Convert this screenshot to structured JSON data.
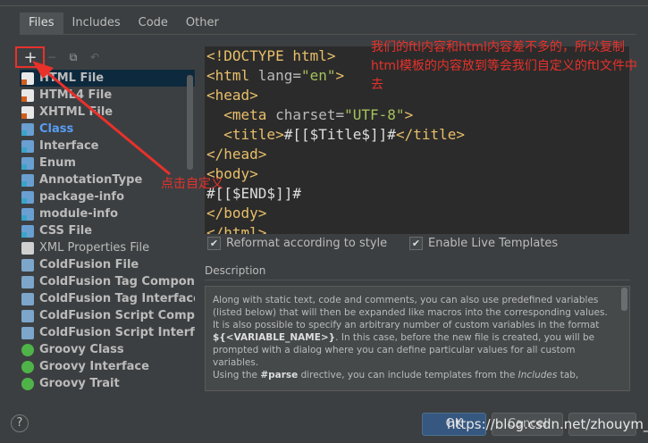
{
  "tabs": [
    "Files",
    "Includes",
    "Code",
    "Other"
  ],
  "toolbar": {
    "add": "+",
    "remove": "−",
    "copy": "⧉",
    "reset": "↶"
  },
  "templates": [
    {
      "label": "HTML File",
      "icon": "html",
      "style": "bold"
    },
    {
      "label": "HTML4 File",
      "icon": "html",
      "style": "bold"
    },
    {
      "label": "XHTML File",
      "icon": "html",
      "style": "bold"
    },
    {
      "label": "Class",
      "icon": "java",
      "style": "blue"
    },
    {
      "label": "Interface",
      "icon": "java",
      "style": "bold"
    },
    {
      "label": "Enum",
      "icon": "java",
      "style": "bold"
    },
    {
      "label": "AnnotationType",
      "icon": "java",
      "style": "bold"
    },
    {
      "label": "package-info",
      "icon": "java",
      "style": "bold"
    },
    {
      "label": "module-info",
      "icon": "java",
      "style": "bold"
    },
    {
      "label": "CSS File",
      "icon": "java",
      "style": "bold"
    },
    {
      "label": "XML Properties File",
      "icon": "text",
      "style": "normal"
    },
    {
      "label": "ColdFusion File",
      "icon": "cf",
      "style": "bold"
    },
    {
      "label": "ColdFusion Tag Component",
      "icon": "cf",
      "style": "bold"
    },
    {
      "label": "ColdFusion Tag Interface",
      "icon": "cf",
      "style": "bold"
    },
    {
      "label": "ColdFusion Script Component",
      "icon": "cf",
      "style": "bold"
    },
    {
      "label": "ColdFusion Script Interface",
      "icon": "cf",
      "style": "bold"
    },
    {
      "label": "Groovy Class",
      "icon": "groovy",
      "style": "bold"
    },
    {
      "label": "Groovy Interface",
      "icon": "groovy",
      "style": "bold"
    },
    {
      "label": "Groovy Trait",
      "icon": "groovy",
      "style": "bold"
    }
  ],
  "editor": {
    "lines": [
      "<!DOCTYPE html>",
      "<html lang=\"en\">",
      "<head>",
      "  <meta charset=\"UTF-8\">",
      "  <title>#[[$Title$]]#</title>",
      "</head>",
      "<body>",
      "#[[$END$]]#",
      "</body>",
      "</html>"
    ]
  },
  "options": {
    "reformat": {
      "label": "Reformat according to style",
      "checked": true
    },
    "live_templates": {
      "label": "Enable Live Templates",
      "checked": true
    }
  },
  "description": {
    "label": "Description",
    "text_1": "Along with static text, code and comments, you can also use predefined variables (listed below) that will then be expanded like macros into the corresponding values.",
    "text_2a": "It is also possible to specify an arbitrary number of custom variables in the format ",
    "text_2b": "${<VARIABLE_NAME>}",
    "text_2c": ". In this case, before the new file is created, you will be prompted with a dialog where you can define particular values for all custom variables.",
    "text_3a": "Using the ",
    "text_3b": "#parse",
    "text_3c": " directive, you can include templates from the ",
    "text_3d": "Includes",
    "text_3e": " tab,"
  },
  "buttons": {
    "help": "?",
    "ok": "OK",
    "cancel": "Cancel"
  },
  "watermark": "https://blog.csdn.net/zhouym_",
  "annotations": {
    "top": "我们的ftl内容和html内容差不多的，所以复制html模板的内容放到等会我们自定义的ftl文件中去",
    "click": "点击自定义"
  },
  "colors": {
    "annotation": "#e8312b",
    "selection": "#0d293e",
    "accent": "#589df6"
  }
}
